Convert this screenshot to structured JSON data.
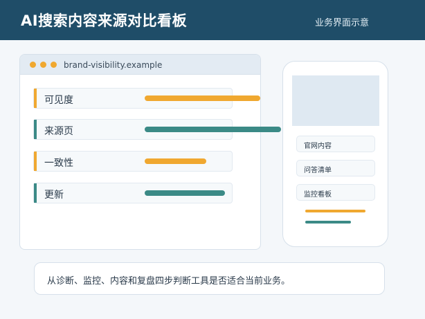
{
  "header": {
    "title": "AI搜索内容来源对比看板",
    "subtitle": "业务界面示意"
  },
  "browser": {
    "url": "brand-visibility.example",
    "metrics": [
      {
        "label": "可见度",
        "value": 0.62,
        "color": "#f0a830"
      },
      {
        "label": "来源页",
        "value": 0.73,
        "color": "#3b8a86"
      },
      {
        "label": "一致性",
        "value": 0.33,
        "color": "#f0a830"
      },
      {
        "label": "更新",
        "value": 0.43,
        "color": "#3b8a86"
      }
    ]
  },
  "phone": {
    "items": [
      {
        "label": "官网内容"
      },
      {
        "label": "问答清单"
      },
      {
        "label": "监控看板"
      }
    ],
    "bars": [
      {
        "value": 0.82,
        "color": "#f0a830"
      },
      {
        "value": 0.62,
        "color": "#3b8a86"
      }
    ]
  },
  "note": {
    "text": "从诊断、监控、内容和复盘四步判断工具是否适合当前业务。"
  },
  "colors": {
    "header_bg": "#1f4d68",
    "accent_orange": "#f0a830",
    "accent_teal": "#3b8a86"
  }
}
